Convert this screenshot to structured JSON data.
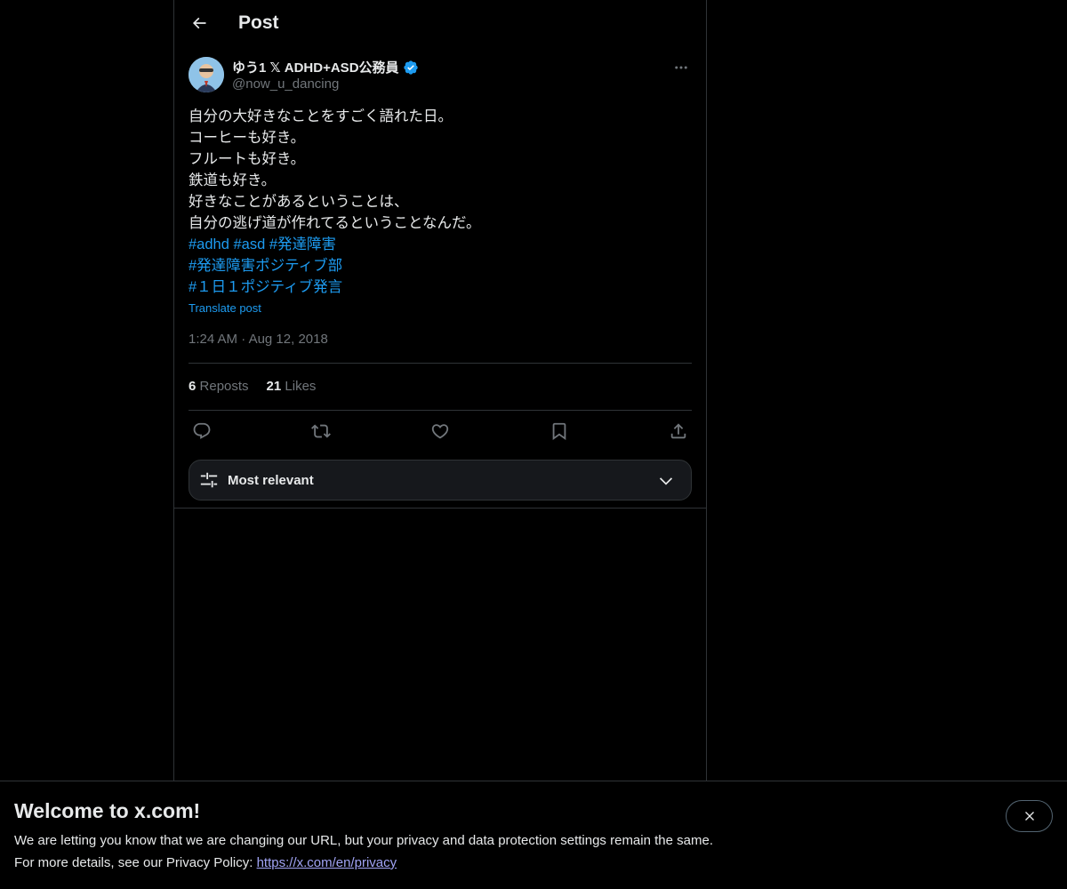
{
  "header": {
    "title": "Post"
  },
  "post": {
    "author": {
      "display_name": "ゆう1 𝕏 ADHD+ASD公務員",
      "handle": "@now_u_dancing",
      "verified": true
    },
    "text_lines": [
      "自分の大好きなことをすごく語れた日。",
      "コーヒーも好き。",
      "フルートも好き。",
      "鉄道も好き。",
      "好きなことがあるということは、",
      "自分の逃げ道が作れてるということなんだ。"
    ],
    "hashtags": {
      "adhd": "#adhd",
      "asd": "#asd",
      "hattatsu": "#発達障害",
      "positive_club": "#発達障害ポジティブ部",
      "daily_positive": "#１日１ポジティブ発言"
    },
    "translate_label": "Translate post",
    "time": "1:24 AM",
    "separator": "·",
    "date": "Aug 12, 2018",
    "reposts_count": "6",
    "reposts_label": "Reposts",
    "likes_count": "21",
    "likes_label": "Likes"
  },
  "actions": {
    "icons": [
      "reply-icon",
      "repost-icon",
      "like-icon",
      "bookmark-icon",
      "share-icon"
    ]
  },
  "replies_sort": {
    "label": "Most relevant"
  },
  "banner": {
    "title": "Welcome to x.com!",
    "line1": "We are letting you know that we are changing our URL, but your privacy and data protection settings remain the same.",
    "line2_prefix": "For more details, see our Privacy Policy: ",
    "link": "https://x.com/en/privacy"
  },
  "colors": {
    "background": "#000000",
    "text": "#e7e9ea",
    "muted": "#71767b",
    "accent": "#1d9bf0",
    "border": "#2f3336",
    "verified": "#1d9bf0",
    "banner_link": "#a1a4f5"
  }
}
